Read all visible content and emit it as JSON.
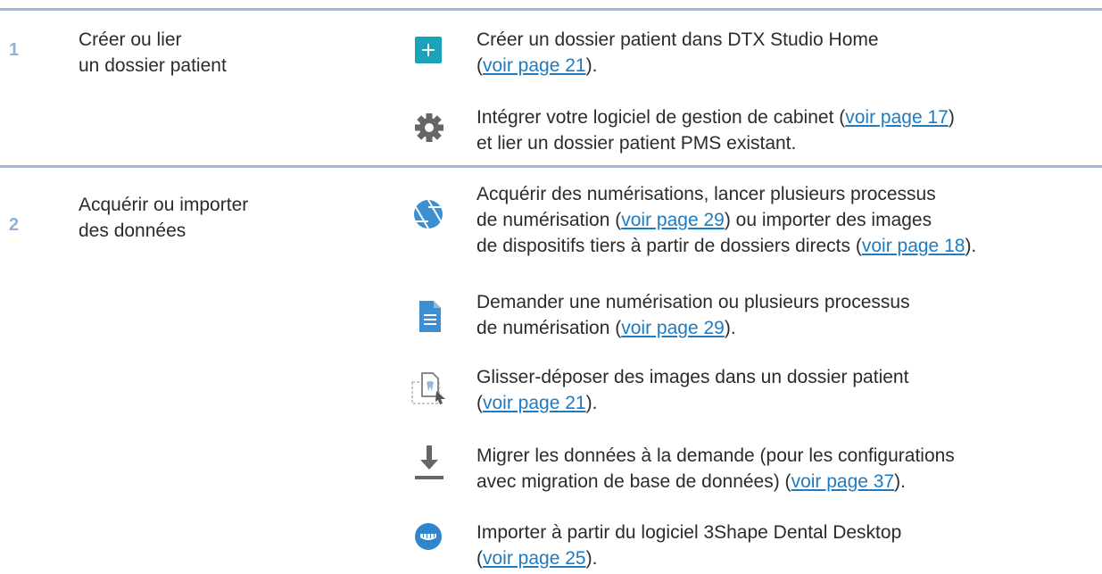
{
  "steps": [
    {
      "number": "1",
      "title_line1": "Créer ou lier",
      "title_line2": "un dossier patient",
      "items": [
        {
          "icon": "plus-icon",
          "text_a": "Créer un dossier patient dans DTX Studio Home",
          "text_b": "(",
          "link": "voir page 21",
          "text_c": ")."
        },
        {
          "icon": "gear-icon",
          "text_a": "Intégrer votre logiciel de gestion de cabinet (",
          "link": "voir page 17",
          "text_b": ")",
          "text_c": "et lier un dossier patient PMS existant."
        }
      ]
    },
    {
      "number": "2",
      "title_line1": "Acquérir ou importer",
      "title_line2": "des données",
      "items": [
        {
          "icon": "camera-aperture-icon",
          "text_a": "Acquérir des numérisations, lancer plusieurs processus",
          "text_b": "de numérisation (",
          "link1": "voir page 29",
          "text_c": ") ou importer des images",
          "text_d": "de dispositifs tiers à partir de dossiers directs (",
          "link2": "voir page 18",
          "text_e": ")."
        },
        {
          "icon": "document-icon",
          "text_a": "Demander une numérisation ou plusieurs processus",
          "text_b": "de numérisation (",
          "link": "voir page 29",
          "text_c": ")."
        },
        {
          "icon": "drag-drop-image-icon",
          "text_a": "Glisser-déposer des images dans un dossier patient",
          "text_b": "(",
          "link": "voir page 21",
          "text_c": ")."
        },
        {
          "icon": "download-icon",
          "text_a": "Migrer les données à la demande (pour les configurations",
          "text_b": "avec migration de base de données) (",
          "link": "voir page 37",
          "text_c": ")."
        },
        {
          "icon": "dental-tray-icon",
          "text_a": "Importer à partir du logiciel 3Shape Dental Desktop",
          "text_b": "(",
          "link": "voir page 25",
          "text_c": ")."
        }
      ]
    }
  ],
  "colors": {
    "rule": "#9fb8d6",
    "step_number": "#8fb2d8",
    "link": "#1e7bc0",
    "accent_teal": "#1aa3b8",
    "icon_gray": "#666666",
    "icon_blue": "#3d8fd1"
  }
}
